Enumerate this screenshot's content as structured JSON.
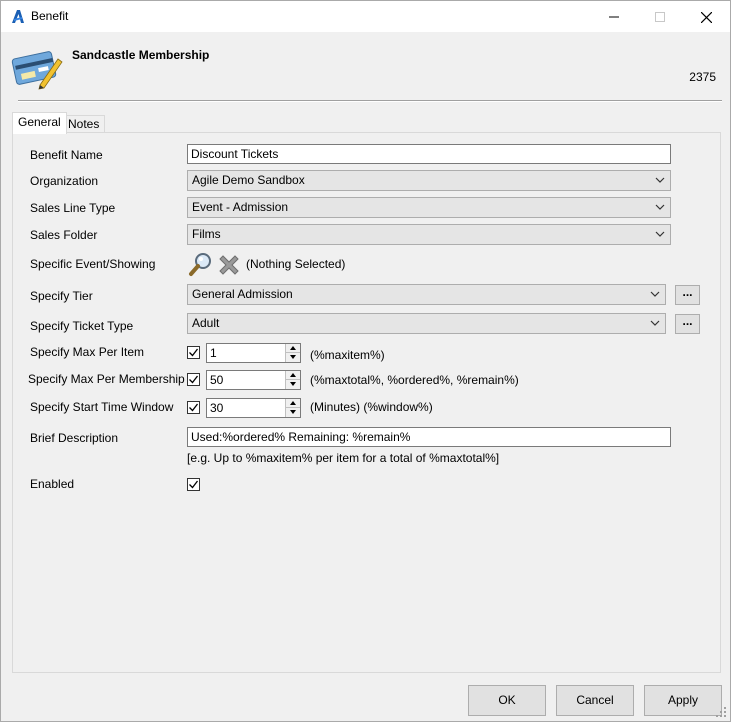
{
  "window": {
    "title": "Benefit",
    "app_icon": "agile-logo-icon"
  },
  "header": {
    "title": "Sandcastle Membership",
    "id": "2375",
    "icon": "membership-card-icon"
  },
  "tabs": [
    {
      "label": "General",
      "active": true
    },
    {
      "label": "Notes",
      "active": false
    }
  ],
  "form": {
    "benefit_name": {
      "label": "Benefit Name",
      "value": "Discount Tickets"
    },
    "organization": {
      "label": "Organization",
      "value": "Agile Demo Sandbox"
    },
    "sales_line_type": {
      "label": "Sales Line Type",
      "value": "Event - Admission"
    },
    "sales_folder": {
      "label": "Sales Folder",
      "value": "Films"
    },
    "specific_event": {
      "label": "Specific Event/Showing",
      "value": "(Nothing Selected)"
    },
    "specify_tier": {
      "label": "Specify Tier",
      "value": "General Admission",
      "browse_label": "..."
    },
    "specify_ticket_type": {
      "label": "Specify Ticket Type",
      "value": "Adult",
      "browse_label": "..."
    },
    "max_per_item": {
      "label": "Specify Max Per Item",
      "checked": true,
      "value": "1",
      "hint": "(%maxitem%)"
    },
    "max_per_membership": {
      "label": "Specify Max Per Membership",
      "checked": true,
      "value": "50",
      "hint": "(%maxtotal%, %ordered%, %remain%)"
    },
    "start_time_window": {
      "label": "Specify Start Time Window",
      "checked": true,
      "value": "30",
      "hint": "(Minutes) (%window%)"
    },
    "brief_description": {
      "label": "Brief Description",
      "value": "Used:%ordered% Remaining: %remain%",
      "hint": "[e.g. Up to %maxitem% per item for a total of %maxtotal%]"
    },
    "enabled": {
      "label": "Enabled",
      "checked": true
    }
  },
  "buttons": {
    "ok": "OK",
    "cancel": "Cancel",
    "apply": "Apply"
  }
}
